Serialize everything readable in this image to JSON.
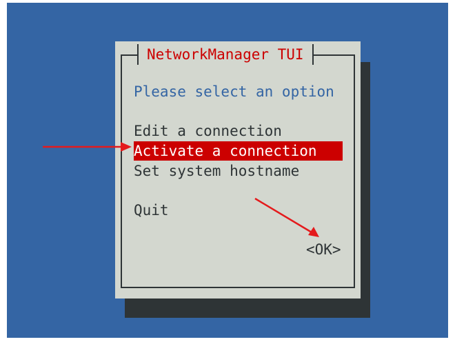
{
  "dialog": {
    "title": "NetworkManager TUI",
    "prompt": "Please select an option",
    "options": [
      "Edit a connection",
      "Activate a connection",
      "Set system hostname",
      "Quit"
    ],
    "selected_option": "Activate a connection",
    "ok_button": "<OK>"
  },
  "colors": {
    "screen_background": "#3465a4",
    "dialog_background": "#d3d7cf",
    "title_text": "#cc0000",
    "selection_background": "#cc0000",
    "annotation_arrow": "#e41a1c"
  }
}
